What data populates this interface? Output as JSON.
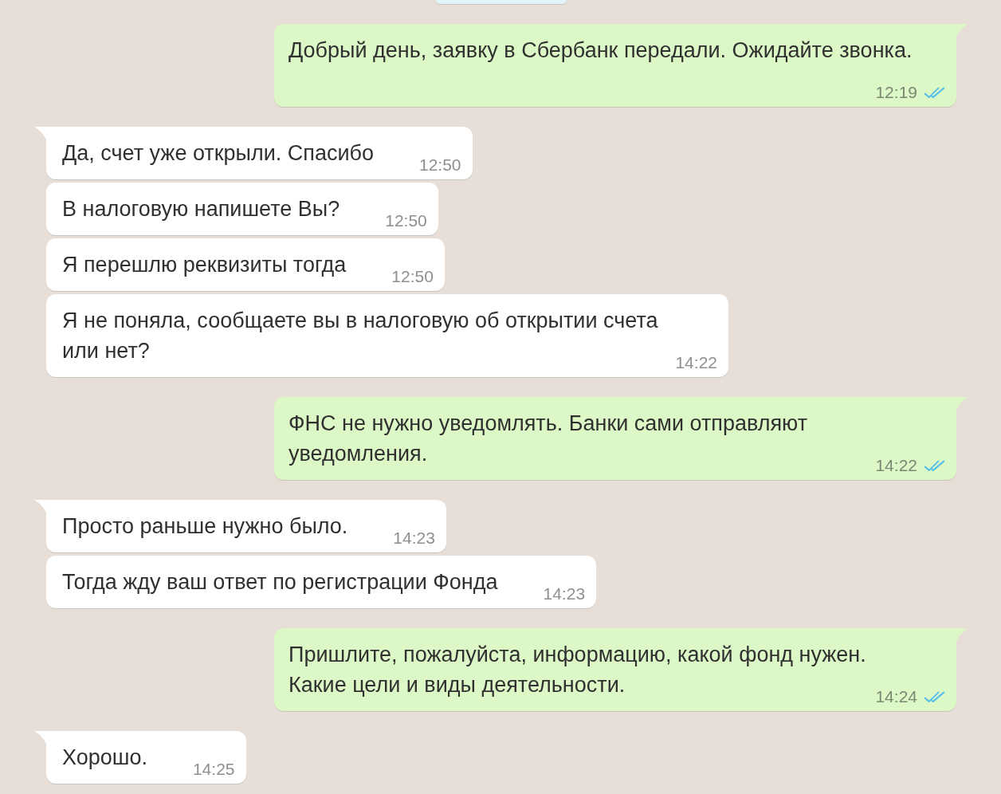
{
  "messages": [
    {
      "kind": "outgoing",
      "tail": true,
      "text": "Добрый день, заявку в Сбербанк передали. Ожидайте звонка.",
      "time": "12:19",
      "read": true
    },
    {
      "kind": "incoming",
      "tail": true,
      "text": "Да, счет уже открыли. Спасибо",
      "time": "12:50"
    },
    {
      "kind": "incoming",
      "tail": false,
      "text": "В налоговую напишете Вы?",
      "time": "12:50"
    },
    {
      "kind": "incoming",
      "tail": false,
      "text": "Я перешлю реквизиты тогда",
      "time": "12:50"
    },
    {
      "kind": "incoming",
      "tail": false,
      "text": "Я не поняла, сообщаете вы в налоговую об открытии счета или нет?",
      "time": "14:22"
    },
    {
      "kind": "outgoing",
      "tail": true,
      "text": "ФНС не нужно уведомлять. Банки сами отправляют уведомления.",
      "time": "14:22",
      "read": true
    },
    {
      "kind": "incoming",
      "tail": true,
      "text": "Просто раньше нужно было.",
      "time": "14:23"
    },
    {
      "kind": "incoming",
      "tail": false,
      "text": "Тогда жду ваш ответ по регистрации Фонда",
      "time": "14:23"
    },
    {
      "kind": "outgoing",
      "tail": true,
      "text": "Пришлите, пожалуйста, информацию, какой фонд нужен. Какие цели и виды деятельности.",
      "time": "14:24",
      "read": true
    },
    {
      "kind": "incoming",
      "tail": true,
      "text": "Хорошо.",
      "time": "14:25"
    }
  ]
}
